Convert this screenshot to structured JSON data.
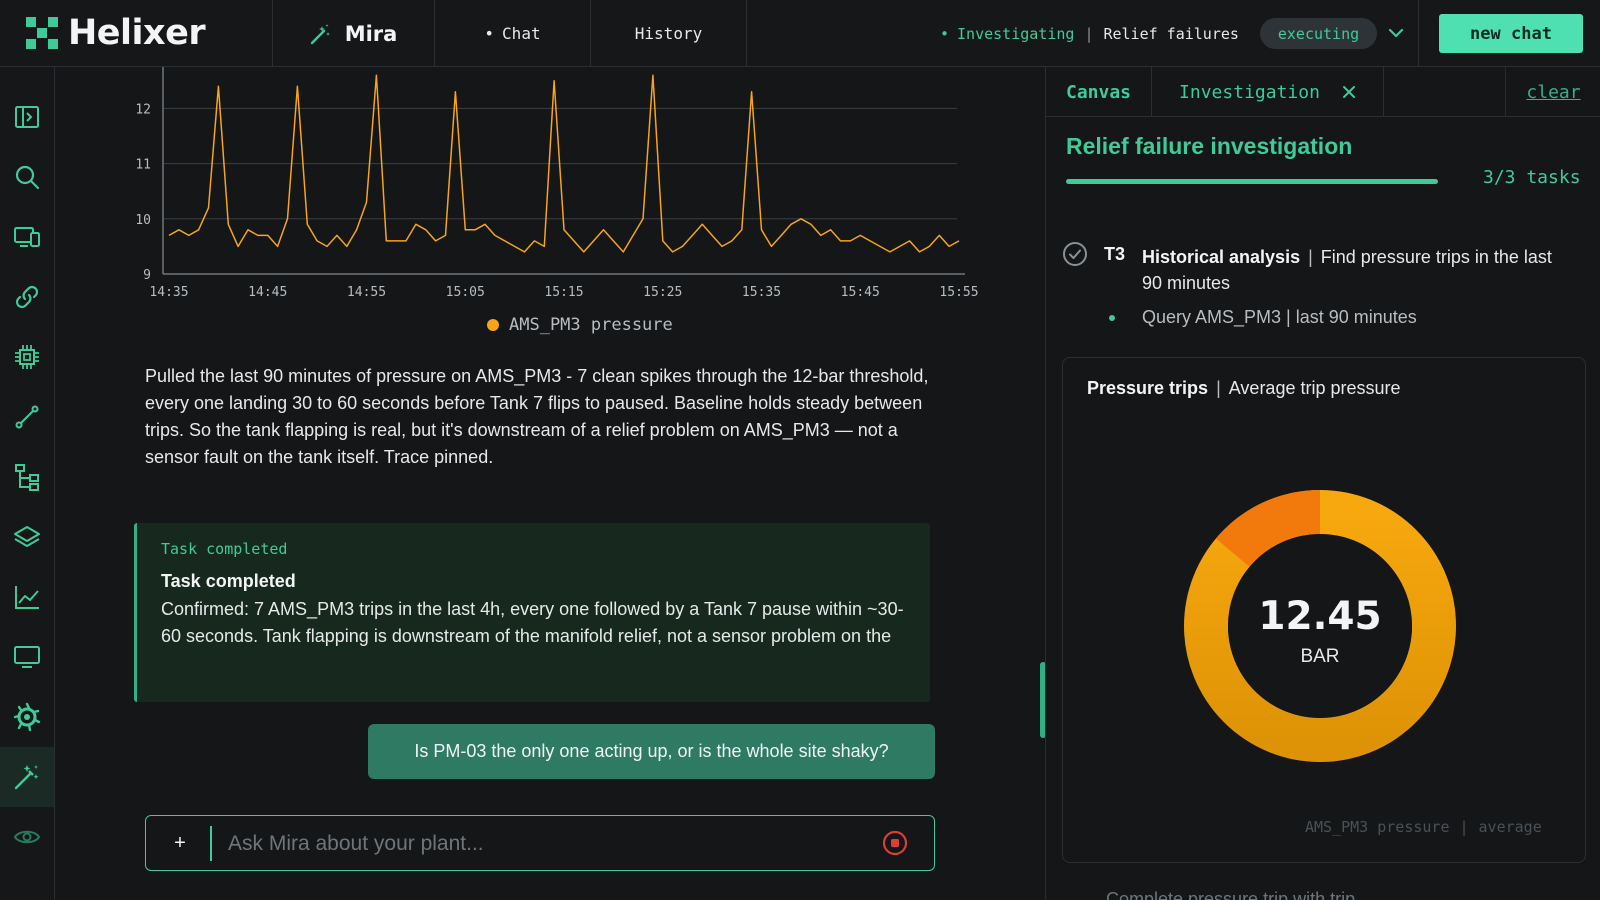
{
  "header": {
    "brand": "Helixer",
    "tabs": {
      "mira": "Mira",
      "chat": "Chat",
      "history": "History"
    },
    "status": {
      "state": "Investigating",
      "context": "Relief failures"
    },
    "executing_badge": "executing",
    "new_chat_label": "new chat"
  },
  "rail": {
    "items": [
      "panel-toggle-icon",
      "search-icon",
      "devices-icon",
      "link-icon",
      "chip-icon",
      "connector-icon",
      "hierarchy-icon",
      "layers-icon",
      "trend-icon",
      "monitor-icon",
      "grafana-icon",
      "magic-wand-icon",
      "eye-icon"
    ],
    "active": "magic-wand-icon"
  },
  "chat": {
    "legend_label": "AMS_PM3 pressure",
    "answer": "Pulled the last 90 minutes of pressure on AMS_PM3 - 7 clean spikes through the 12-bar threshold, every one landing 30 to 60 seconds before Tank 7 flips to paused. Baseline holds steady between trips. So the tank flapping is real, but it's downstream of a relief problem on AMS_PM3 — not a sensor fault on the tank itself. Trace pinned.",
    "task_card": {
      "kicker": "Task completed",
      "title": "Task completed",
      "body": "Confirmed: 7 AMS_PM3 trips in the last 4h, every one followed by a Tank 7 pause within ~30-60 seconds. Tank flapping is downstream of the manifold relief, not a sensor problem on the"
    },
    "user_message": "Is PM-03 the only one acting up, or is the whole site shaky?",
    "composer": {
      "plus": "+",
      "placeholder": "Ask Mira about your plant..."
    }
  },
  "chart_data": {
    "type": "line",
    "series": [
      {
        "name": "AMS_PM3 pressure",
        "color": "#f6a51a"
      }
    ],
    "x": [
      "14:35",
      "14:36",
      "14:37",
      "14:38",
      "14:39",
      "14:40",
      "14:41",
      "14:42",
      "14:43",
      "14:44",
      "14:45",
      "14:46",
      "14:47",
      "14:48",
      "14:49",
      "14:50",
      "14:51",
      "14:52",
      "14:53",
      "14:54",
      "14:55",
      "14:56",
      "14:57",
      "14:58",
      "14:59",
      "15:00",
      "15:01",
      "15:02",
      "15:03",
      "15:04",
      "15:05",
      "15:06",
      "15:07",
      "15:08",
      "15:09",
      "15:10",
      "15:11",
      "15:12",
      "15:13",
      "15:14",
      "15:15",
      "15:16",
      "15:17",
      "15:18",
      "15:19",
      "15:20",
      "15:21",
      "15:22",
      "15:23",
      "15:24",
      "15:25",
      "15:26",
      "15:27",
      "15:28",
      "15:29",
      "15:30",
      "15:31",
      "15:32",
      "15:33",
      "15:34",
      "15:35",
      "15:36",
      "15:37",
      "15:38",
      "15:39",
      "15:40",
      "15:41",
      "15:42",
      "15:43",
      "15:44",
      "15:45",
      "15:46",
      "15:47",
      "15:48",
      "15:49",
      "15:50",
      "15:51",
      "15:52",
      "15:53",
      "15:54",
      "15:55"
    ],
    "values": [
      9.7,
      9.8,
      9.7,
      9.8,
      10.2,
      12.4,
      9.9,
      9.5,
      9.8,
      9.7,
      9.7,
      9.5,
      10.0,
      12.4,
      9.9,
      9.6,
      9.5,
      9.7,
      9.5,
      9.8,
      10.3,
      12.6,
      9.6,
      9.6,
      9.6,
      9.9,
      9.8,
      9.6,
      9.7,
      12.3,
      9.8,
      9.8,
      9.9,
      9.7,
      9.6,
      9.5,
      9.4,
      9.6,
      9.5,
      12.5,
      9.8,
      9.6,
      9.4,
      9.6,
      9.8,
      9.6,
      9.4,
      9.7,
      10.0,
      12.6,
      9.6,
      9.4,
      9.5,
      9.7,
      9.9,
      9.7,
      9.5,
      9.6,
      9.8,
      12.3,
      9.8,
      9.5,
      9.7,
      9.9,
      10.0,
      9.9,
      9.7,
      9.8,
      9.6,
      9.6,
      9.7,
      9.6,
      9.5,
      9.4,
      9.5,
      9.6,
      9.4,
      9.5,
      9.7,
      9.5,
      9.6
    ],
    "x_ticks": [
      "14:35",
      "14:45",
      "14:55",
      "15:05",
      "15:15",
      "15:25",
      "15:35",
      "15:45",
      "15:55"
    ],
    "y_ticks": [
      9,
      10,
      11,
      12
    ],
    "ylim": [
      9,
      12.75
    ],
    "grid": true,
    "legend": "bottom"
  },
  "panel": {
    "tabs": {
      "canvas": "Canvas",
      "investigation": "Investigation",
      "clear": "clear"
    },
    "title": "Relief failure investigation",
    "progress": 1.0,
    "task_count": "3/3 tasks",
    "task": {
      "id": "T3",
      "name": "Historical analysis",
      "desc": "Find pressure trips in the last 90 minutes",
      "sub": "Query AMS_PM3 | last 90 minutes"
    },
    "gauge": {
      "title": "Pressure trips",
      "subtitle": "Average trip pressure",
      "value": "12.45",
      "unit": "BAR",
      "foot_metric": "AMS_PM3 pressure",
      "foot_agg": "average",
      "colors": {
        "main": "#f0a20c",
        "accent": "#f27a0c"
      }
    },
    "next_line": "Complete pressure trip with trip"
  }
}
